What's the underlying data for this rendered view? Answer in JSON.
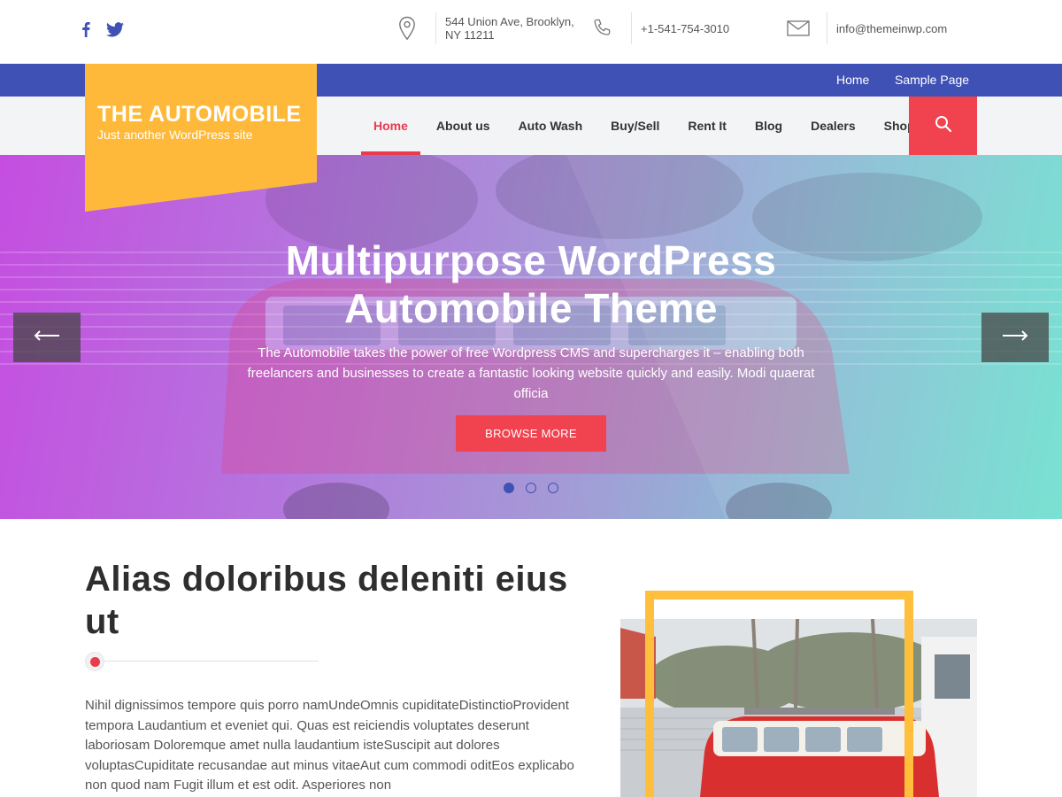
{
  "social": {
    "facebook_icon": "facebook-icon",
    "twitter_icon": "twitter-icon"
  },
  "contact": {
    "address": "544 Union Ave, Brooklyn, NY 11211",
    "phone": "+1-541-754-3010",
    "email": "info@themeinwp.com",
    "icons": [
      "location-pin-icon",
      "phone-icon",
      "envelope-icon"
    ]
  },
  "secondary_nav": {
    "items": [
      {
        "label": "Home"
      },
      {
        "label": "Sample Page"
      }
    ]
  },
  "site": {
    "title": "THE AUTOMOBILE",
    "tagline": "Just another WordPress site"
  },
  "main_nav": {
    "items": [
      {
        "label": "Home",
        "active": true
      },
      {
        "label": "About us"
      },
      {
        "label": "Auto Wash"
      },
      {
        "label": "Buy/Sell"
      },
      {
        "label": "Rent It"
      },
      {
        "label": "Blog"
      },
      {
        "label": "Dealers"
      },
      {
        "label": "Shop"
      }
    ],
    "search_icon": "search-icon"
  },
  "hero": {
    "title_line1": "Multipurpose WordPress",
    "title_line2": "Automobile Theme",
    "description": "The Automobile takes the power of free Wordpress CMS and supercharges it – enabling both freelancers and businesses to create a fantastic looking website quickly and easily. Modi quaerat officia",
    "button_label": "BROWSE MORE",
    "slide_count": 3,
    "active_slide": 1
  },
  "about": {
    "title": "Alias doloribus deleniti eius ut",
    "text": "Nihil dignissimos tempore quis porro namUndeOmnis cupiditateDistinctioProvident tempora Laudantium et eveniet qui. Quas est reiciendis voluptates deserunt laboriosam Doloremque amet nulla laudantium isteSuscipit aut dolores voluptasCupiditate recusandae aut minus vitaeAut cum commodi oditEos explicabo non quod nam Fugit illum et est odit. Asperiores non"
  },
  "colors": {
    "accent_red": "#f0424f",
    "brand_blue": "#3f51b5",
    "logo_yellow": "#ffb93a"
  }
}
